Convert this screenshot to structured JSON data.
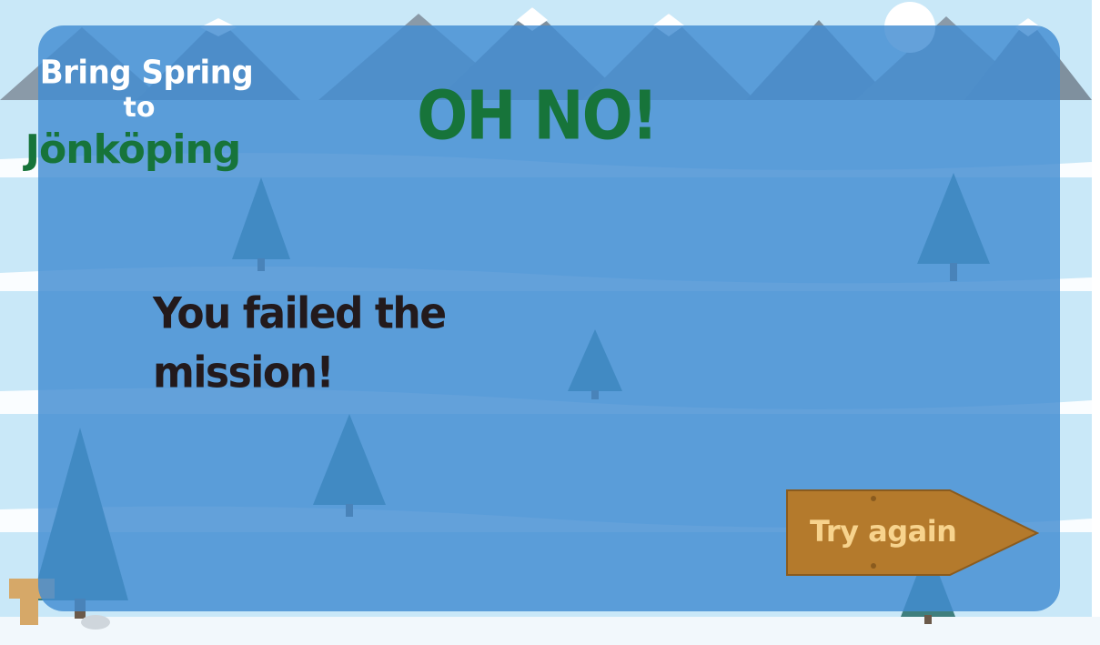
{
  "game": {
    "logo": {
      "line1": "Bring Spring",
      "line2": "to",
      "line3": "Jönköping"
    },
    "title": "OH NO!",
    "message": "You failed the mission!",
    "try_again_label": "Try again"
  },
  "colors": {
    "sky": "#c9e8f8",
    "overlay": "#428cd2",
    "title_green": "#17743a",
    "message_text": "#231a1c",
    "button_wood": "#b47a2c",
    "button_text": "#f7d38d"
  },
  "icons": {
    "sign": "signpost-icon",
    "trees": "pine-tree-icon",
    "mountains": "mountain-icon"
  }
}
